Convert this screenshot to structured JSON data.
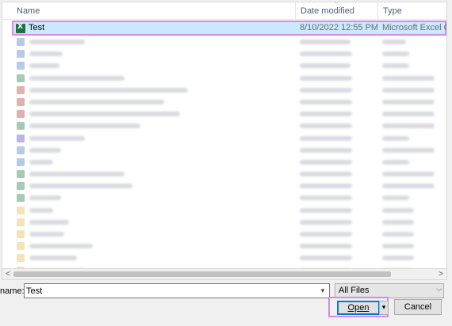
{
  "header": {
    "col_name": "Name",
    "col_date": "Date modified",
    "col_type": "Type"
  },
  "selected_file": {
    "name": "Test",
    "date": "8/10/2022 12:55 PM",
    "type": "Microsoft Excel C..."
  },
  "rows": [
    {
      "icon": "blue",
      "name_w": 70,
      "date_w": 64,
      "type_w": 30
    },
    {
      "icon": "blue",
      "name_w": 42,
      "date_w": 66,
      "type_w": 34
    },
    {
      "icon": "blue",
      "name_w": 38,
      "date_w": 64,
      "type_w": 34
    },
    {
      "icon": "green",
      "name_w": 120,
      "date_w": 66,
      "type_w": 66
    },
    {
      "icon": "red",
      "name_w": 200,
      "date_w": 66,
      "type_w": 66
    },
    {
      "icon": "red",
      "name_w": 170,
      "date_w": 66,
      "type_w": 66
    },
    {
      "icon": "red",
      "name_w": 190,
      "date_w": 66,
      "type_w": 66
    },
    {
      "icon": "green",
      "name_w": 140,
      "date_w": 66,
      "type_w": 66
    },
    {
      "icon": "purple",
      "name_w": 70,
      "date_w": 66,
      "type_w": 34
    },
    {
      "icon": "blue",
      "name_w": 40,
      "date_w": 66,
      "type_w": 66
    },
    {
      "icon": "blue",
      "name_w": 30,
      "date_w": 66,
      "type_w": 34
    },
    {
      "icon": "green",
      "name_w": 120,
      "date_w": 66,
      "type_w": 66
    },
    {
      "icon": "green",
      "name_w": 130,
      "date_w": 66,
      "type_w": 66
    },
    {
      "icon": "green",
      "name_w": 40,
      "date_w": 66,
      "type_w": 34
    },
    {
      "icon": "folder",
      "name_w": 30,
      "date_w": 66,
      "type_w": 40
    },
    {
      "icon": "folder",
      "name_w": 50,
      "date_w": 66,
      "type_w": 40
    },
    {
      "icon": "folder",
      "name_w": 44,
      "date_w": 66,
      "type_w": 40
    },
    {
      "icon": "folder",
      "name_w": 80,
      "date_w": 66,
      "type_w": 40
    },
    {
      "icon": "folder",
      "name_w": 60,
      "date_w": 66,
      "type_w": 40
    },
    {
      "icon": "folder",
      "name_w": 70,
      "date_w": 66,
      "type_w": 40
    }
  ],
  "footer": {
    "filename_label": "name:",
    "filename_value": "Test",
    "filter_value": "All Files",
    "open_label": "Open",
    "cancel_label": "Cancel"
  },
  "colors": {
    "selection": "#cce8ff",
    "highlight_outline": "#d38de3",
    "excel_green": "#1d7145",
    "focus_blue": "#0078d7"
  }
}
